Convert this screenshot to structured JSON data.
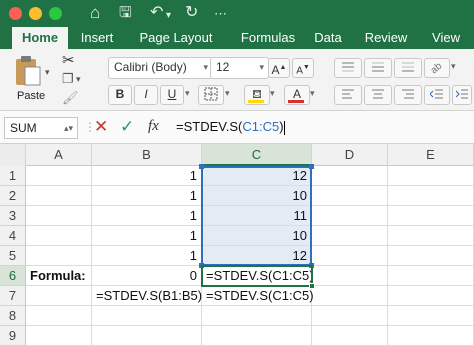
{
  "ribbon_tabs": [
    "Home",
    "Insert",
    "Page Layout",
    "Formulas",
    "Data",
    "Review",
    "View"
  ],
  "clipboard": {
    "paste_label": "Paste"
  },
  "font": {
    "name": "Calibri (Body)",
    "size": "12"
  },
  "formula_bar": {
    "name_box": "SUM",
    "fx_label": "fx",
    "formula_prefix": "=STDEV.S(",
    "formula_range": "C1:C5",
    "formula_suffix": ")"
  },
  "columns": [
    "A",
    "B",
    "C",
    "D",
    "E"
  ],
  "rows": [
    {
      "num": "1",
      "A": "",
      "B": "1",
      "C": "12",
      "D": "",
      "E": ""
    },
    {
      "num": "2",
      "A": "",
      "B": "1",
      "C": "10",
      "D": "",
      "E": ""
    },
    {
      "num": "3",
      "A": "",
      "B": "1",
      "C": "11",
      "D": "",
      "E": ""
    },
    {
      "num": "4",
      "A": "",
      "B": "1",
      "C": "10",
      "D": "",
      "E": ""
    },
    {
      "num": "5",
      "A": "",
      "B": "1",
      "C": "12",
      "D": "",
      "E": ""
    },
    {
      "num": "6",
      "A": "Formula:",
      "B": "0",
      "C": "=STDEV.S(C1:C5)",
      "D": "",
      "E": ""
    },
    {
      "num": "7",
      "A": "",
      "B": "=STDEV.S(B1:B5)",
      "C": "=STDEV.S(C1:C5)",
      "D": "",
      "E": ""
    },
    {
      "num": "8",
      "A": "",
      "B": "",
      "C": "",
      "D": "",
      "E": ""
    },
    {
      "num": "9",
      "A": "",
      "B": "",
      "C": "",
      "D": "",
      "E": ""
    }
  ],
  "colors": {
    "excel_green": "#217346",
    "range_blue": "#2f6fbd",
    "highlight": "#e3ebf5",
    "font_color_red": "#d9302b",
    "fill_yellow": "#ffd800"
  }
}
